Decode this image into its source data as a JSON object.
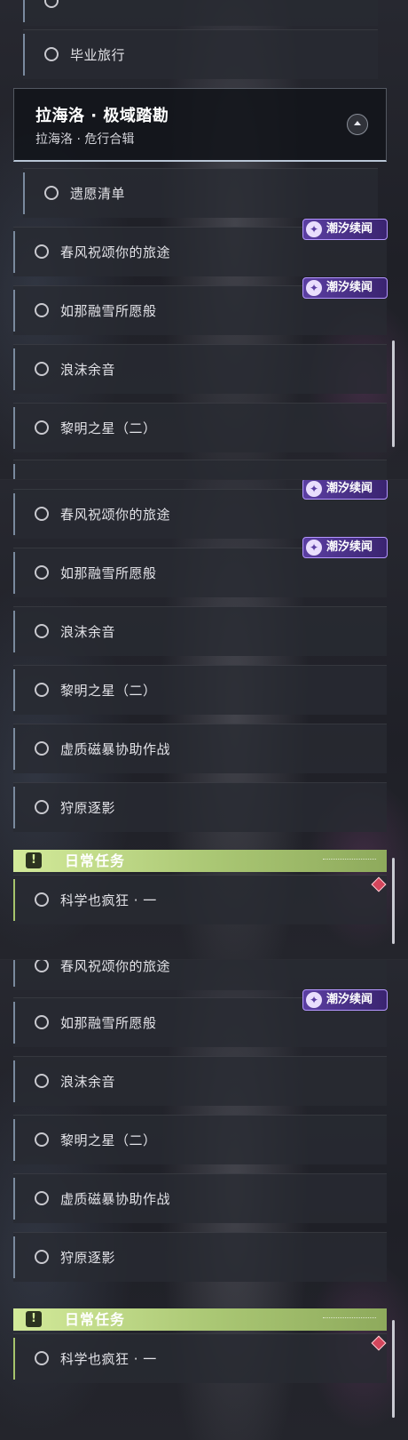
{
  "panel1": {
    "top_item": "毕业旅行",
    "expanded": {
      "title": "拉海洛 · 极域踏勘",
      "subtitle": "拉海洛 · 危行合辑"
    },
    "items": [
      "遗愿清单",
      "春风祝颂你的旅途",
      "如那融雪所愿般",
      "浪沫余音",
      "黎明之星（二）"
    ]
  },
  "panel2": {
    "items": [
      "春风祝颂你的旅途",
      "如那融雪所愿般",
      "浪沫余音",
      "黎明之星（二）",
      "虚质磁暴协助作战",
      "狩原逐影"
    ],
    "daily_title": "日常任务",
    "daily_items": [
      "科学也疯狂 · 一"
    ]
  },
  "panel3": {
    "items": [
      "春风祝颂你的旅途",
      "如那融雪所愿般",
      "浪沫余音",
      "黎明之星（二）",
      "虚质磁暴协助作战",
      "狩原逐影"
    ],
    "daily_title": "日常任务",
    "daily_items": [
      "科学也疯狂 · 一"
    ]
  },
  "badge_label": "潮汐续闻",
  "badge_icon": "sparkle-feather-icon",
  "daily_icon": "alert-icon",
  "colors": {
    "badge": "#5b3fa2",
    "daily": "#a9c673",
    "marker": "#d4465c"
  }
}
